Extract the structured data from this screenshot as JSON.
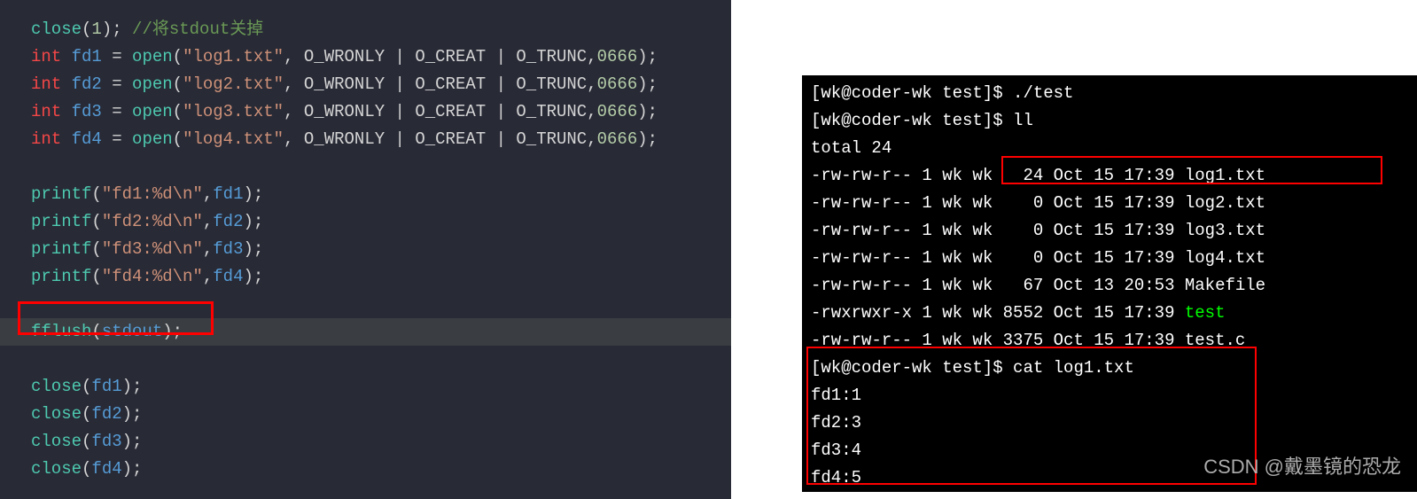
{
  "code": {
    "close_fn": "close",
    "close_arg": "1",
    "comment": "//将stdout关掉",
    "int_kw": "int ",
    "open_fn": "open",
    "wronly": "O_WRONLY",
    "creat": "O_CREAT",
    "trunc": "O_TRUNC",
    "mode": "0666",
    "fd1": "fd1",
    "fd2": "fd2",
    "fd3": "fd3",
    "fd4": "fd4",
    "log1": "\"log1.txt\"",
    "log2": "\"log2.txt\"",
    "log3": "\"log3.txt\"",
    "log4": "\"log4.txt\"",
    "printf_fn": "printf",
    "pstr1": "\"fd1:%d\\n\"",
    "pstr2": "\"fd2:%d\\n\"",
    "pstr3": "\"fd3:%d\\n\"",
    "pstr4": "\"fd4:%d\\n\"",
    "fflush_fn": "fflush",
    "stdout": "stdout",
    "closefd_fn": "close"
  },
  "term": {
    "line1": "[wk@coder-wk test]$ ./test",
    "line2": "[wk@coder-wk test]$ ll",
    "line3": "total 24",
    "l1_perm": "-rw-rw-r-- 1 wk wk   24 Oct 15 17:39 log1.txt",
    "l2_perm": "-rw-rw-r-- 1 wk wk    0 Oct 15 17:39 log2.txt",
    "l3_perm": "-rw-rw-r-- 1 wk wk    0 Oct 15 17:39 log3.txt",
    "l4_perm": "-rw-rw-r-- 1 wk wk    0 Oct 15 17:39 log4.txt",
    "l5_perm": "-rw-rw-r-- 1 wk wk   67 Oct 13 20:53 Makefile",
    "l6_left": "-rwxrwxr-x 1 wk wk 8552 Oct 15 17:39 ",
    "l6_file": "test",
    "l7_perm": "-rw-rw-r-- 1 wk wk 3375 Oct 15 17:39 test.c",
    "cat_cmd": "[wk@coder-wk test]$ cat log1.txt",
    "out1": "fd1:1",
    "out2": "fd2:3",
    "out3": "fd3:4",
    "out4": "fd4:5"
  },
  "watermark": "CSDN @戴墨镜的恐龙"
}
